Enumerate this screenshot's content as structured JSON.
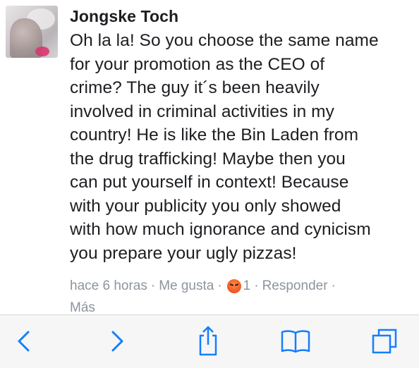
{
  "comment": {
    "author": "Jongske Toch",
    "lines": [
      "Oh la la! So you choose the same name",
      "for your promotion as the CEO of",
      "crime? The guy it´s been heavily",
      "involved in criminal activities in my",
      "country! He is like the Bin Laden from",
      "the drug trafficking! Maybe then you",
      "can put yourself in context! Because",
      "with your publicity you only showed",
      "with how much ignorance and cynicism",
      "you prepare your ugly pizzas!"
    ],
    "time": "hace 6 horas",
    "separator": "·",
    "like_label": "Me gusta",
    "reaction_icon": "angry-reaction-icon",
    "reaction_count": "1",
    "reply_label": "Responder",
    "more_label": "Más"
  },
  "toolbar": {
    "icons": [
      "back-icon",
      "forward-icon",
      "share-icon",
      "bookmarks-icon",
      "tabs-icon"
    ],
    "accent_color": "#157efb"
  }
}
